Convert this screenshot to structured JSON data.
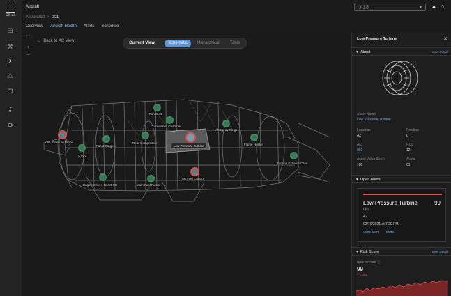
{
  "app": {
    "title": "Aircraft",
    "selector_value": "X18"
  },
  "breadcrumb": {
    "root": "All Aircraft",
    "sep": ">",
    "current": "001"
  },
  "tabs": [
    "Overview",
    "Aircraft Health",
    "Alerts",
    "Schedule"
  ],
  "rail_brand": "CS.ai",
  "canvas": {
    "back_label": "Back to AC View",
    "view_label": "Current View",
    "views": [
      "Schematic",
      "Hierarchical",
      "Table"
    ],
    "parts": {
      "fan_duct": "Fan Duct",
      "combustion_chamber": "Combustion Chamber",
      "aft_spray_rings": "Aft Spray Rings",
      "inlet_pressure_probe": "Inlet Pressure Probe",
      "fan_3_stages": "Fan 3 Stages",
      "rear_compressor": "Rear Compressor",
      "low_pressure_turbine": "Low Pressure Turbine",
      "flame_holder": "Flame Holder",
      "ctvv": "CTVV",
      "turbine_exhaust_case": "Turbine Exhaust Case",
      "engine_driven_gearbox": "Engine Driven GearBOX",
      "main_fuel_pump": "Main Fuel Pump",
      "ab_fuel_control": "AB Fuel Control"
    }
  },
  "panel": {
    "title": "Low Pressure Turbine",
    "about_label": "About",
    "view_detail": "View Detail",
    "asset_name_key": "Asset Name",
    "asset_name": "Low Pressure Turbine",
    "location_key": "Location",
    "location": "AZ",
    "position_key": "Position",
    "position": "L",
    "ac_key": "AC",
    "ac": "001",
    "rul_key": "RUL",
    "rul": "12",
    "asset_value_key": "Asset Value Score",
    "asset_value": "100",
    "alerts_key": "Alerts",
    "alerts": "01",
    "open_alerts_label": "Open Alerts",
    "alert": {
      "title": "Low Pressure Turbine",
      "score": "99",
      "ac": "001",
      "location": "AZ",
      "datetime": "02/10/2021 at 7:20 PM",
      "view_label": "View Alert",
      "mute_label": "Mute"
    },
    "risk_label": "Risk Score",
    "risk_score_key": "RISK SCORE",
    "risk_score": "99",
    "risk_delta": "+ 3.18%"
  },
  "colors": {
    "accent": "#5d97db",
    "alert": "#e3534f",
    "ok": "#3d8f4d"
  }
}
